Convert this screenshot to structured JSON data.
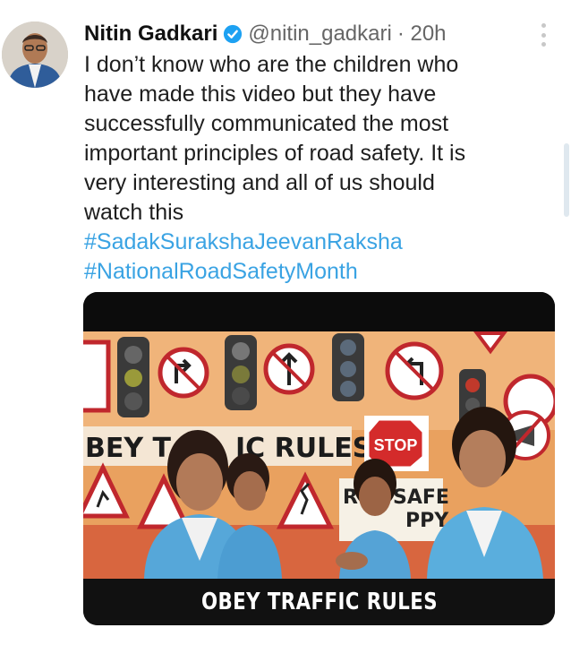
{
  "tweet": {
    "author_name": "Nitin Gadkari",
    "handle": "@nitin_gadkari",
    "time": "· 20h",
    "text_lines": [
      "I don’t know who are the children who",
      "have made this video but they have",
      "successfully communicated the most",
      "important principles of road safety. It is",
      "very interesting and all of us should",
      "watch this"
    ],
    "hashtags": [
      "#SadakSurakshaJeevanRaksha",
      "#NationalRoadSafetyMonth"
    ],
    "media": {
      "banner_text": "BEY T",
      "banner_text2": "IC RULES",
      "stop_sign": "STOP",
      "sign_r": "R",
      "sign_safe": "SAFE",
      "sign_ppy": "PPY",
      "caption": "OBEY TRAFFIC RULES"
    }
  },
  "colors": {
    "hashtag": "#3aa3e3",
    "verified": "#1da1f2"
  }
}
